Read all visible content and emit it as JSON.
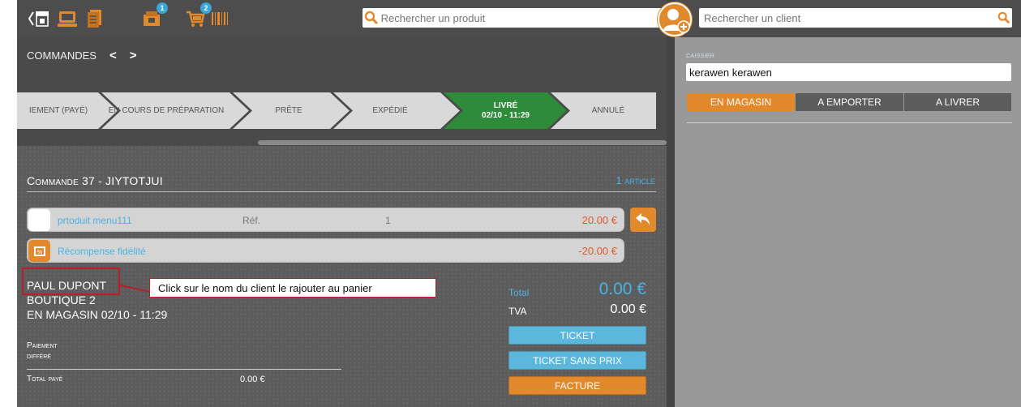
{
  "colors": {
    "accent": "#e2892b",
    "blue": "#4ab4e2",
    "green": "#2e8b3a",
    "red": "#e25a2e",
    "highlight": "#b81e2b"
  },
  "topbar": {
    "icons": [
      "back-shop-icon",
      "pos-terminal-icon",
      "notes-icon",
      "orders-icon",
      "cart-icon",
      "barcode-icon"
    ],
    "orders_badge": "1",
    "cart_badge": "2",
    "search_product_placeholder": "Rechercher un produit"
  },
  "commandes": {
    "label": "COMMANDES",
    "prev": "<",
    "next": ">"
  },
  "steps": [
    {
      "label": "IEMENT (PAYÉ)",
      "state": "done"
    },
    {
      "label": "EN COURS DE PRÉPARATION",
      "state": "done"
    },
    {
      "label": "PRÊTE",
      "state": "done"
    },
    {
      "label": "EXPÉDIÉ",
      "state": "done"
    },
    {
      "label": "LIVRÉ",
      "sub": "02/10 - 11:29",
      "state": "active"
    },
    {
      "label": "ANNULÉ",
      "state": "done"
    }
  ],
  "order": {
    "title": "Commande 37 - JIYTOTJUI",
    "article_count": "1 article",
    "lines": [
      {
        "name": "prtoduit menu111",
        "ref": "Réf.",
        "qty": "1",
        "price": "20.00 €"
      },
      {
        "name": "Récompense fidélité",
        "price": "-20.00 €"
      }
    ],
    "client_name": "PAUL DUPONT",
    "boutique": "BOUTIQUE 2",
    "mode_date": "EN MAGASIN 02/10 - 11:29",
    "tooltip": "Click sur le nom du client le rajouter au panier",
    "paiement_label_1": "Paiement",
    "paiement_label_2": "différé",
    "total_paye_label": "Total payé",
    "total_paye_value": "0.00 €",
    "total_label": "Total",
    "total_value": "0.00 €",
    "tva_label": "TVA",
    "tva_value": "0.00 €",
    "buttons": {
      "ticket": "TICKET",
      "ticket_sans_prix": "TICKET SANS PRIX",
      "facture": "FACTURE"
    }
  },
  "right": {
    "search_client_placeholder": "Rechercher un client",
    "caissier_label": "CAISSIER",
    "caissier_value": "kerawen kerawen",
    "modes": [
      {
        "label": "EN MAGASIN",
        "active": true
      },
      {
        "label": "A EMPORTER",
        "active": false
      },
      {
        "label": "A LIVRER",
        "active": false
      }
    ]
  }
}
